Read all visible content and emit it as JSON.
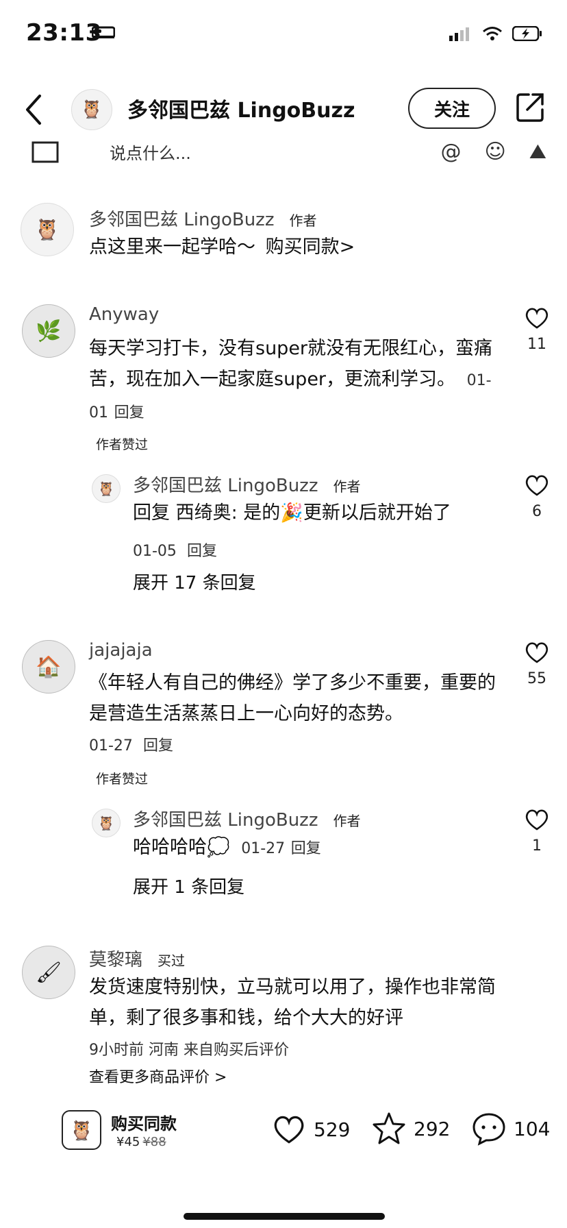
{
  "status_bar": {
    "time": "23:13"
  },
  "header": {
    "title": "多邻国巴兹 LingoBuzz",
    "follow_label": "关注"
  },
  "compose": {
    "placeholder": "说点什么..."
  },
  "author_note": {
    "name": "多邻国巴兹 LingoBuzz",
    "tag": "作者",
    "text": "点这里来一起学哈～",
    "link": "购买同款>"
  },
  "comments": [
    {
      "name": "Anyway",
      "text": "每天学习打卡，没有super就没有无限红心，蛮痛苦，现在加入一起家庭super，更流利学习。",
      "date": "01-01",
      "reply": "回复",
      "likes": "11",
      "author_liked": "作者赞过",
      "sub_reply": {
        "name": "多邻国巴兹 LingoBuzz",
        "tag": "作者",
        "text": "回复 西绮奥: 是的🎉更新以后就开始了",
        "date": "01-05",
        "reply": "回复",
        "likes": "6"
      },
      "expand": "展开 17 条回复"
    },
    {
      "name": "jajajaja",
      "text": "《年轻人有自己的佛经》学了多少不重要，重要的是营造生活蒸蒸日上一心向好的态势。",
      "date": "01-27",
      "reply": "回复",
      "likes": "55",
      "author_liked": "作者赞过",
      "sub_reply": {
        "name": "多邻国巴兹 LingoBuzz",
        "tag": "作者",
        "text": "哈哈哈哈💭",
        "date": "01-27",
        "reply": "回复",
        "likes": "1"
      },
      "expand": "展开 1 条回复"
    },
    {
      "name": "莫黎璃",
      "tag": "买过",
      "text": "发货速度特别快，立马就可以用了，操作也非常简单，剩了很多事和钱，给个大大的好评",
      "meta": "9小时前 河南 来自购买后评价",
      "more": "查看更多商品评价 >"
    }
  ],
  "bottom_bar": {
    "buy_label": "购买同款",
    "price": "¥45",
    "old_price": "¥88",
    "likes": "529",
    "favorites": "292",
    "comments": "104"
  }
}
